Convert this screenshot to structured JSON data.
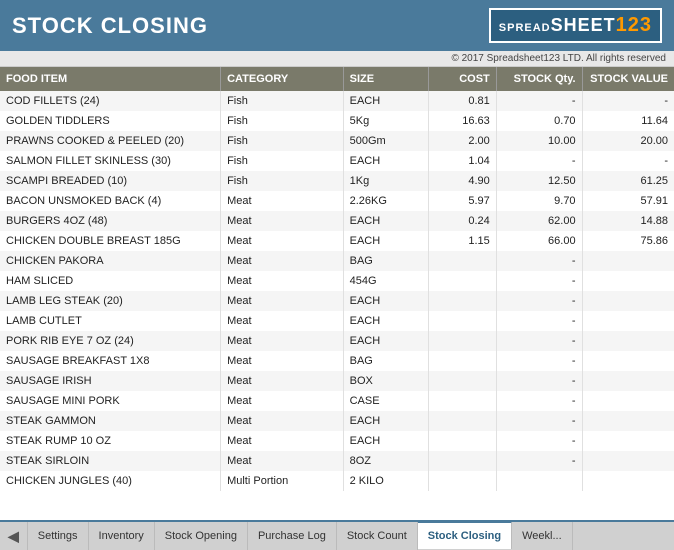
{
  "header": {
    "title": "STOCK CLOSING",
    "copyright": "© 2017 Spreadsheet123 LTD. All rights reserved"
  },
  "logo": {
    "spread": "SPREAD",
    "sheet": "SHEET",
    "number": "123"
  },
  "table": {
    "columns": [
      {
        "key": "food",
        "label": "FOOD ITEM"
      },
      {
        "key": "category",
        "label": "CATEGORY"
      },
      {
        "key": "size",
        "label": "SIZE"
      },
      {
        "key": "cost",
        "label": "COST"
      },
      {
        "key": "stock_qty",
        "label": "STOCK Qty."
      },
      {
        "key": "stock_val",
        "label": "STOCK VALUE"
      }
    ],
    "rows": [
      {
        "food": "COD FILLETS (24)",
        "category": "Fish",
        "size": "EACH",
        "cost": "0.81",
        "stock_qty": "-",
        "stock_val": "-"
      },
      {
        "food": "GOLDEN TIDDLERS",
        "category": "Fish",
        "size": "5Kg",
        "cost": "16.63",
        "stock_qty": "0.70",
        "stock_val": "11.64"
      },
      {
        "food": "PRAWNS COOKED & PEELED (20)",
        "category": "Fish",
        "size": "500Gm",
        "cost": "2.00",
        "stock_qty": "10.00",
        "stock_val": "20.00"
      },
      {
        "food": "SALMON FILLET SKINLESS (30)",
        "category": "Fish",
        "size": "EACH",
        "cost": "1.04",
        "stock_qty": "-",
        "stock_val": "-"
      },
      {
        "food": "SCAMPI BREADED (10)",
        "category": "Fish",
        "size": "1Kg",
        "cost": "4.90",
        "stock_qty": "12.50",
        "stock_val": "61.25"
      },
      {
        "food": "BACON UNSMOKED BACK (4)",
        "category": "Meat",
        "size": "2.26KG",
        "cost": "5.97",
        "stock_qty": "9.70",
        "stock_val": "57.91"
      },
      {
        "food": "BURGERS 4OZ (48)",
        "category": "Meat",
        "size": "EACH",
        "cost": "0.24",
        "stock_qty": "62.00",
        "stock_val": "14.88"
      },
      {
        "food": "CHICKEN DOUBLE BREAST 185G",
        "category": "Meat",
        "size": "EACH",
        "cost": "1.15",
        "stock_qty": "66.00",
        "stock_val": "75.86"
      },
      {
        "food": "CHICKEN PAKORA",
        "category": "Meat",
        "size": "BAG",
        "cost": "",
        "stock_qty": "-",
        "stock_val": ""
      },
      {
        "food": "HAM SLICED",
        "category": "Meat",
        "size": "454G",
        "cost": "",
        "stock_qty": "-",
        "stock_val": ""
      },
      {
        "food": "LAMB LEG STEAK (20)",
        "category": "Meat",
        "size": "EACH",
        "cost": "",
        "stock_qty": "-",
        "stock_val": ""
      },
      {
        "food": "LAMB CUTLET",
        "category": "Meat",
        "size": "EACH",
        "cost": "",
        "stock_qty": "-",
        "stock_val": ""
      },
      {
        "food": "PORK RIB EYE 7 OZ (24)",
        "category": "Meat",
        "size": "EACH",
        "cost": "",
        "stock_qty": "-",
        "stock_val": ""
      },
      {
        "food": "SAUSAGE BREAKFAST 1X8",
        "category": "Meat",
        "size": "BAG",
        "cost": "",
        "stock_qty": "-",
        "stock_val": ""
      },
      {
        "food": "SAUSAGE IRISH",
        "category": "Meat",
        "size": "BOX",
        "cost": "",
        "stock_qty": "-",
        "stock_val": ""
      },
      {
        "food": "SAUSAGE MINI PORK",
        "category": "Meat",
        "size": "CASE",
        "cost": "",
        "stock_qty": "-",
        "stock_val": ""
      },
      {
        "food": "STEAK GAMMON",
        "category": "Meat",
        "size": "EACH",
        "cost": "",
        "stock_qty": "-",
        "stock_val": ""
      },
      {
        "food": "STEAK RUMP 10 OZ",
        "category": "Meat",
        "size": "EACH",
        "cost": "",
        "stock_qty": "-",
        "stock_val": ""
      },
      {
        "food": "STEAK SIRLOIN",
        "category": "Meat",
        "size": "8OZ",
        "cost": "",
        "stock_qty": "-",
        "stock_val": ""
      },
      {
        "food": "CHICKEN JUNGLES (40)",
        "category": "Multi Portion",
        "size": "2 KILO",
        "cost": "",
        "stock_qty": "",
        "stock_val": ""
      }
    ]
  },
  "tabs": [
    {
      "label": "◀",
      "active": false,
      "key": "prev"
    },
    {
      "label": "Settings",
      "active": false,
      "key": "settings"
    },
    {
      "label": "Inventory",
      "active": false,
      "key": "inventory"
    },
    {
      "label": "Stock Opening",
      "active": false,
      "key": "stock-opening"
    },
    {
      "label": "Purchase Log",
      "active": false,
      "key": "purchase-log"
    },
    {
      "label": "Stock Count",
      "active": false,
      "key": "stock-count"
    },
    {
      "label": "Stock Closing",
      "active": true,
      "key": "stock-closing"
    },
    {
      "label": "Weekl...",
      "active": false,
      "key": "weekly"
    }
  ]
}
